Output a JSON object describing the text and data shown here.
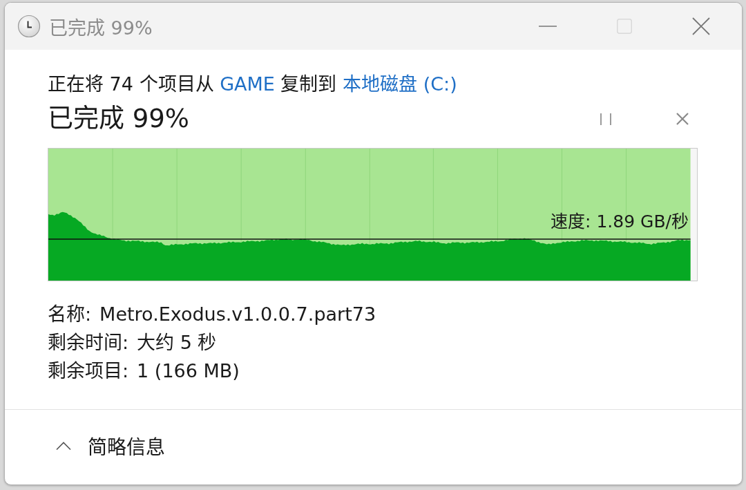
{
  "window": {
    "title": "已完成 99%",
    "buttons": [
      {
        "kind": "minimize",
        "disabled": false
      },
      {
        "kind": "maximize",
        "disabled": true
      },
      {
        "kind": "close",
        "disabled": false
      }
    ]
  },
  "summary": [
    {
      "kind": "text",
      "text": "正在将 74 个项目从"
    },
    {
      "kind": "link",
      "text": "GAME"
    },
    {
      "kind": "text",
      "text": "复制到"
    },
    {
      "kind": "link",
      "text": "本地磁盘 (C:)"
    }
  ],
  "progress": {
    "heading": "已完成 99%",
    "level": 0.99,
    "speed": "速度: 1.89 GB/秒"
  },
  "details": [
    {
      "label": "名称:",
      "value": "Metro.Exodus.v1.0.0.7.part73"
    },
    {
      "label": "剩余时间:",
      "value": "大约 5 秒"
    },
    {
      "label": "剩余项目:",
      "value": "1 (166 MB)"
    }
  ],
  "footer": {
    "label": "简略信息",
    "expanded": true
  }
}
